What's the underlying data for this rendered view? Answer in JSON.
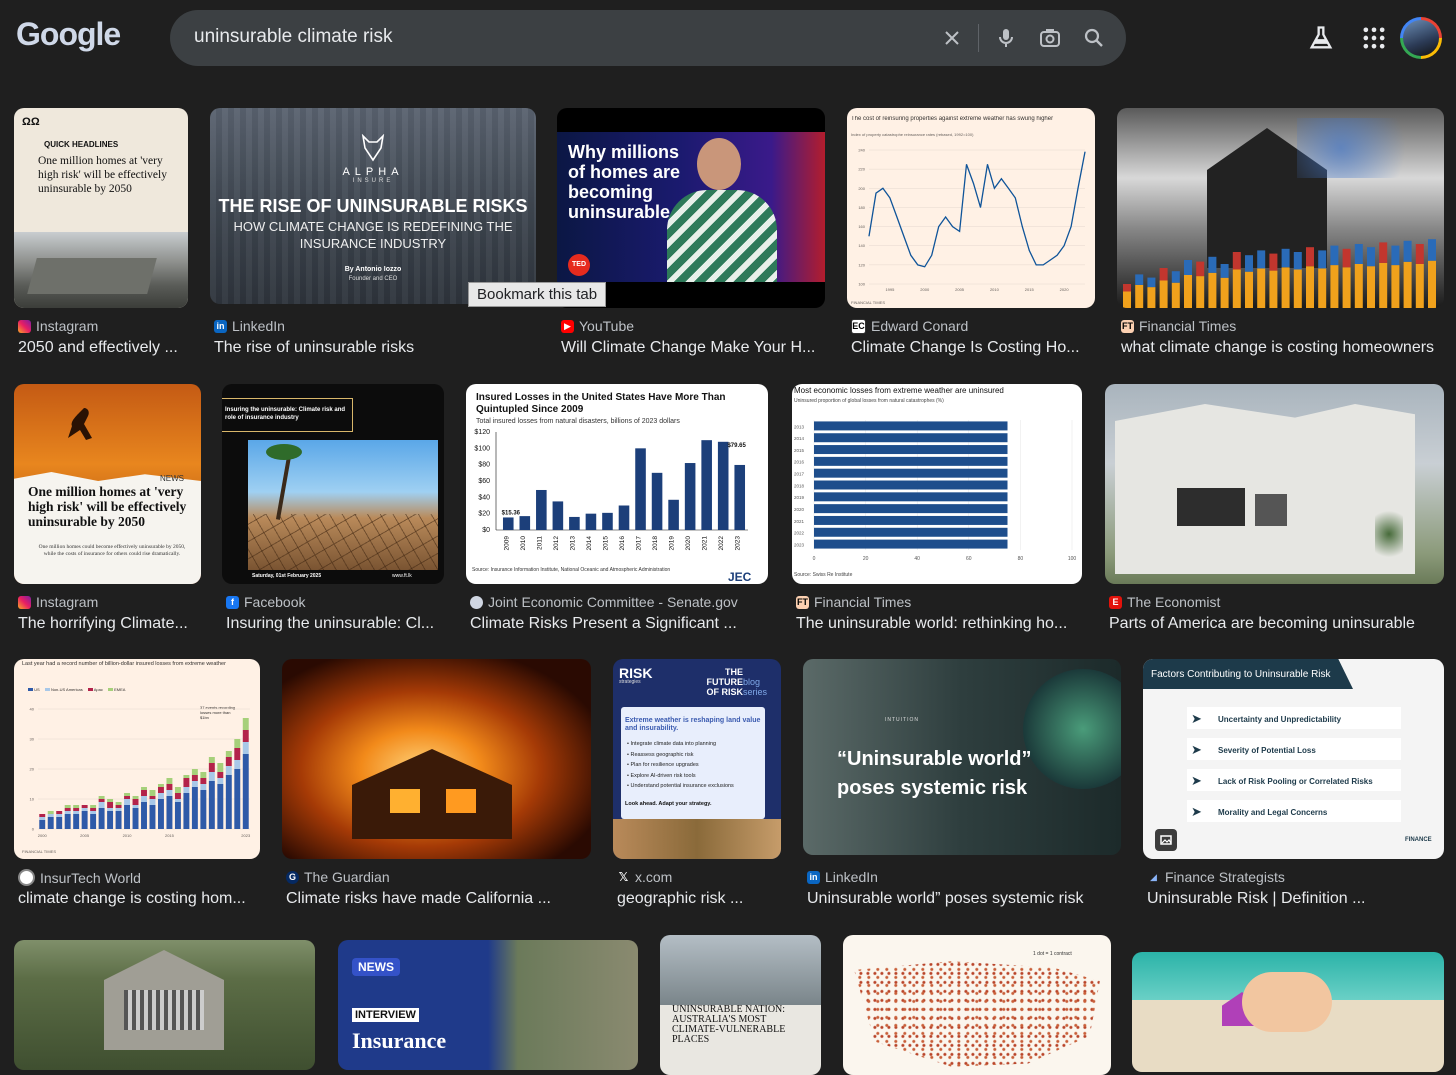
{
  "header": {
    "logo": "Google",
    "search_value": "uninsurable climate risk"
  },
  "tooltip": "Bookmark this tab",
  "results": [
    {
      "source": "Instagram",
      "title": "2050 and effectively ...",
      "thumb": {
        "kicker": "QUICK HEADLINES",
        "headline": "One million homes at 'very high risk' will be effectively uninsurable by 2050"
      }
    },
    {
      "source": "LinkedIn",
      "title": "The rise of uninsurable risks",
      "thumb": {
        "brand": "ALPHA",
        "brand_sub": "INSURE",
        "headline": "THE RISE OF UNINSURABLE RISKS",
        "sub": "HOW CLIMATE CHANGE IS REDEFINING THE INSURANCE INDUSTRY",
        "byline": "By Antonio Iozzo",
        "byline2": "Founder and CEO"
      }
    },
    {
      "source": "YouTube",
      "title": "Will Climate Change Make Your H...",
      "thumb": {
        "headline": "Why millions of homes are becoming uninsurable",
        "badge": "TED"
      }
    },
    {
      "source": "Edward Conard",
      "title": "Climate Change Is Costing Ho...",
      "thumb": {
        "caption": "The cost of reinsuring properties against extreme weather has swung higher",
        "sub": "Index of property catastrophe reinsurance rates (rebased, 1992=100)",
        "footer": "FINANCIAL TIMES"
      }
    },
    {
      "source": "Financial Times",
      "title": "what climate change is costing homeowners",
      "thumb": {}
    },
    {
      "source": "Instagram",
      "title": "The horrifying Climate...",
      "thumb": {
        "brand": "NEWS",
        "headline": "One million homes at 'very high risk' will be effectively uninsurable by 2050",
        "sub": "One million homes could become effectively uninsurable by 2050, while the costs of insurance for others could rise dramatically."
      }
    },
    {
      "source": "Facebook",
      "title": "Insuring the uninsurable: Cl...",
      "thumb": {
        "headline": "Insuring the uninsurable: Climate risk and role of insurance industry",
        "date": "Saturday, 01st February 2025",
        "site": "www.ft.lk"
      }
    },
    {
      "source": "Joint Economic Committee - Senate.gov",
      "title": "Climate Risks Present a Significant ...",
      "thumb": {
        "headline": "Insured Losses in the United States Have More Than Quintupled Since 2009",
        "sub": "Total insured losses from natural disasters, billions of 2023 dollars",
        "first_label": "$15.36",
        "last_label": "$79.65",
        "source": "Source: Insurance Information Institute, National Oceanic and Atmospheric Administration",
        "logo": "JEC"
      }
    },
    {
      "source": "Financial Times",
      "title": "The uninsurable world: rethinking ho...",
      "thumb": {
        "headline": "Most economic losses from extreme weather are uninsured",
        "sub": "Uninsured proportion of global losses from natural catastrophes (%)",
        "source": "Source: Swiss Re Institute"
      }
    },
    {
      "source": "The Economist",
      "title": "Parts of America are becoming uninsurable",
      "thumb": {}
    },
    {
      "source": "InsurTech World",
      "title": "climate change is costing hom...",
      "thumb": {
        "headline": "Last year had a record number of billion-dollar insured losses from extreme weather",
        "legend": [
          "US",
          "Non-US Americas",
          "Apac",
          "EMEA"
        ],
        "annot": "37 events recording losses more than $1bn",
        "footer": "FINANCIAL TIMES"
      }
    },
    {
      "source": "The Guardian",
      "title": "Climate risks have made California ...",
      "thumb": {}
    },
    {
      "source": "x.com",
      "title": "geographic risk ...",
      "thumb": {
        "brand": "RISK",
        "brand_sub": "strategies",
        "series": "THE FUTURE OF RISK",
        "series_tag": "blog series",
        "headline": "Extreme weather is reshaping land value and insurability.",
        "bullets": [
          "Integrate climate data into planning",
          "Reassess geographic risk",
          "Plan for resilience upgrades",
          "Explore AI-driven risk tools",
          "Understand potential insurance exclusions"
        ],
        "footer": "Look ahead. Adapt your strategy."
      }
    },
    {
      "source": "LinkedIn",
      "title": "Uninsurable world” poses systemic risk",
      "thumb": {
        "brand": "INTUITION",
        "headline": "“Uninsurable world” poses systemic risk"
      }
    },
    {
      "source": "Finance Strategists",
      "title": "Uninsurable Risk | Definition ...",
      "thumb": {
        "header": "Factors Contributing to Uninsurable Risk",
        "items": [
          "Uncertainty and Unpredictability",
          "Severity of Potential Loss",
          "Lack of Risk Pooling or Correlated Risks",
          "Morality and Legal Concerns"
        ],
        "logo": "FINANCE"
      }
    },
    {
      "thumb": {}
    },
    {
      "thumb": {
        "brand": "NEWS",
        "tag": "INTERVIEW",
        "headline": "Insurance"
      }
    },
    {
      "thumb": {
        "headline": "UNINSURABLE NATION: AUSTRALIA'S MOST CLIMATE-VULNERABLE PLACES"
      }
    },
    {
      "thumb": {
        "legend": "1 dot = 1 contract"
      }
    },
    {
      "thumb": {}
    }
  ],
  "chart_data": [
    {
      "type": "line",
      "title": "The cost of reinsuring properties against extreme weather has swung higher",
      "ylabel": "Index of property catastrophe reinsurance rates (rebased, 1992=100)",
      "x": [
        1992,
        1993,
        1994,
        1995,
        1996,
        1997,
        1998,
        1999,
        2000,
        2001,
        2002,
        2003,
        2004,
        2005,
        2006,
        2007,
        2008,
        2009,
        2010,
        2011,
        2012,
        2013,
        2014,
        2015,
        2016,
        2017,
        2018,
        2019,
        2020,
        2021,
        2022,
        2023
      ],
      "values": [
        150,
        195,
        200,
        190,
        170,
        150,
        130,
        120,
        118,
        130,
        160,
        170,
        160,
        155,
        225,
        205,
        180,
        225,
        200,
        210,
        200,
        190,
        160,
        135,
        120,
        120,
        125,
        130,
        140,
        160,
        200,
        238
      ],
      "ylim": [
        100,
        240
      ],
      "yticks": [
        100,
        120,
        140,
        160,
        180,
        200,
        220,
        240
      ],
      "xticks": [
        "1995",
        "2000",
        "2005",
        "2010",
        "2015",
        "2020"
      ]
    },
    {
      "type": "bar",
      "title": "Insured Losses in the United States Have More Than Quintupled Since 2009",
      "ylabel": "Total insured losses from natural disasters, billions of 2023 dollars",
      "categories": [
        "2009",
        "2010",
        "2011",
        "2012",
        "2013",
        "2014",
        "2015",
        "2016",
        "2017",
        "2018",
        "2019",
        "2020",
        "2021",
        "2022",
        "2023"
      ],
      "values": [
        15.36,
        17,
        49,
        35,
        16,
        20,
        21,
        30,
        100,
        70,
        37,
        82,
        110,
        108,
        79.65
      ],
      "ylim": [
        0,
        120
      ],
      "yticks": [
        "$0",
        "$20",
        "$40",
        "$60",
        "$80",
        "$100",
        "$120"
      ]
    },
    {
      "type": "bar",
      "title": "Most economic losses from extreme weather are uninsured",
      "ylabel": "Uninsured proportion of global losses from natural catastrophes (%)",
      "categories": [
        "2013",
        "2014",
        "2015",
        "2016",
        "2017",
        "2018",
        "2019",
        "2020",
        "2021",
        "2022",
        "2023"
      ],
      "values": [
        75,
        75,
        75,
        75,
        75,
        75,
        75,
        75,
        75,
        75,
        75
      ],
      "xlim": [
        0,
        100
      ],
      "xticks": [
        "0",
        "20",
        "40",
        "60",
        "80",
        "100"
      ]
    },
    {
      "type": "bar",
      "title": "Last year had a record number of billion-dollar insured losses from extreme weather",
      "series": [
        {
          "name": "US",
          "values": [
            3,
            4,
            4,
            5,
            5,
            6,
            5,
            7,
            6,
            6,
            8,
            7,
            9,
            8,
            10,
            11,
            9,
            12,
            14,
            13,
            16,
            15,
            18,
            20,
            25
          ]
        },
        {
          "name": "Non-US Americas",
          "values": [
            1,
            1,
            1,
            1,
            1,
            1,
            1,
            2,
            1,
            1,
            2,
            1,
            2,
            2,
            2,
            2,
            1,
            2,
            2,
            2,
            3,
            2,
            3,
            3,
            4
          ]
        },
        {
          "name": "Apac",
          "values": [
            1,
            0,
            1,
            1,
            1,
            1,
            1,
            1,
            2,
            1,
            1,
            2,
            2,
            1,
            2,
            2,
            2,
            3,
            2,
            2,
            3,
            2,
            3,
            4,
            4
          ]
        },
        {
          "name": "EMEA",
          "values": [
            0,
            1,
            0,
            1,
            1,
            0,
            1,
            1,
            1,
            1,
            1,
            1,
            1,
            2,
            1,
            2,
            2,
            1,
            2,
            2,
            2,
            3,
            2,
            3,
            4
          ]
        }
      ],
      "ylim": [
        0,
        40
      ],
      "yticks": [
        "0",
        "10",
        "20",
        "30",
        "40"
      ],
      "xticks": [
        "2000",
        "2005",
        "2010",
        "2015",
        "2023"
      ]
    }
  ]
}
